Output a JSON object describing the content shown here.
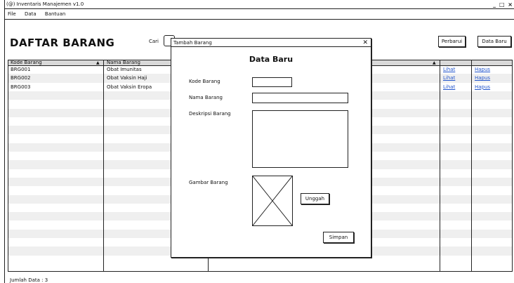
{
  "window": {
    "title": "(@) Inventaris Manajemen v1.0",
    "controls": "_ □ ×"
  },
  "menu": [
    "File",
    "Data",
    "Bantuan"
  ],
  "page": {
    "heading": "DAFTAR BARANG",
    "search_label": "Cari",
    "refresh_label": "Perbarui",
    "new_data_label": "Data Baru"
  },
  "table": {
    "columns": [
      "Kode Barang",
      "Nama Barang"
    ],
    "sort_indicator": "▲",
    "rows": [
      {
        "code": "BRG001",
        "name": "Obat Imunitas",
        "view": "Lihat",
        "delete": "Hapus"
      },
      {
        "code": "BRG002",
        "name": "Obat Vaksin Haji",
        "view": "Lihat",
        "delete": "Hapus"
      },
      {
        "code": "BRG003",
        "name": "Obat Vaksin Eropa",
        "view": "Lihat",
        "delete": "Hapus"
      }
    ]
  },
  "status": "Jumlah Data : 3",
  "dialog": {
    "title": "Tambah Barang",
    "close": "✕",
    "heading": "Data Baru",
    "fields": {
      "code_label": "Kode Barang",
      "name_label": "Nama Barang",
      "desc_label": "Deskripsi Barang",
      "image_label": "Gambar Barang"
    },
    "upload_label": "Unggah",
    "save_label": "Simpan"
  }
}
